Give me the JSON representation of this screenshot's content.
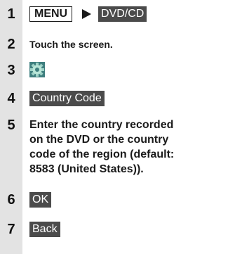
{
  "steps": [
    {
      "num": "1",
      "menu_label": "MENU",
      "arrow_icon": "triangle-right-icon",
      "button_label": "DVD/CD"
    },
    {
      "num": "2",
      "text": "Touch the screen."
    },
    {
      "num": "3",
      "icon": "gear-settings-icon"
    },
    {
      "num": "4",
      "button_label": "Country Code"
    },
    {
      "num": "5",
      "lines": [
        "Enter the country recorded",
        "on the DVD or the country",
        "code of the region (default:",
        "8583 (United States))."
      ]
    },
    {
      "num": "6",
      "button_label": "OK"
    },
    {
      "num": "7",
      "button_label": "Back"
    }
  ],
  "colors": {
    "number_column": "#e3e3e3",
    "button_bg": "#4b4b4b",
    "button_text": "#ffffff",
    "gear_icon": "#5aa5a5"
  }
}
